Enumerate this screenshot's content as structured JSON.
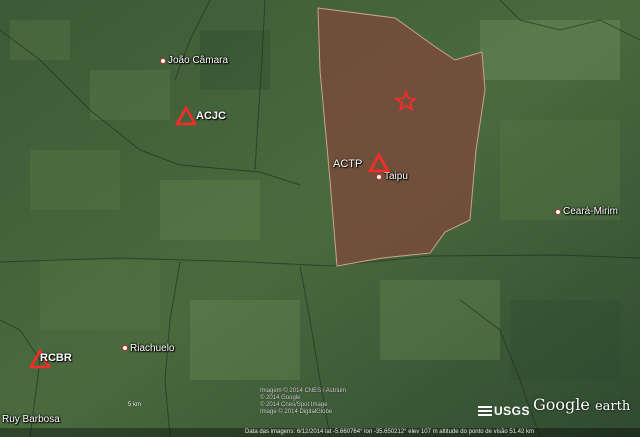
{
  "map": {
    "places": {
      "joao_camara": "João Câmara",
      "taipu": "Taipu",
      "ceara_mirim": "Ceará-Mirim",
      "riachuelo": "Riachuelo",
      "ruy_barbosa": "Ruy Barbosa"
    },
    "stations": {
      "acjc": "ACJC",
      "actp": "ACTP",
      "rcbr": "RCBR"
    },
    "colors": {
      "station_triangle": "#ff2a2a",
      "region_fill": "#7a4a3a",
      "region_border": "#c9a38a",
      "star": "#ff2a2a"
    }
  },
  "credits": {
    "line1": "Imagem © 2014 CNES / Astrium",
    "line2": "© 2014 Google",
    "line3": "© 2014 Cnes/Spot Image",
    "line4": "Image © 2014 DigitalGlobe"
  },
  "scale_label": "5 km",
  "logos": {
    "usgs": "USGS",
    "google_earth_a": "Google",
    "google_earth_b": "earth"
  },
  "statusbar": {
    "text": "Data das imagens: 6/12/2014   lat -5.660764°   lon -35.650212°   elev  107 m   altitude do ponto de visão  51.42 km"
  }
}
